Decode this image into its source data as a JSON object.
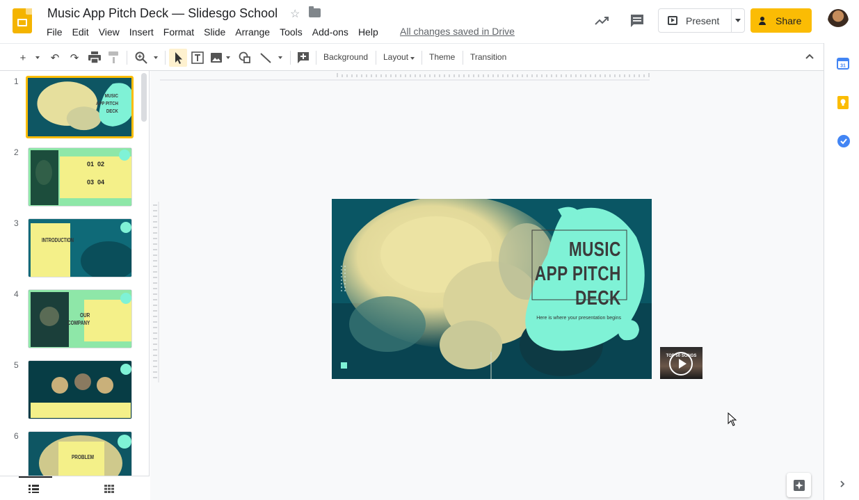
{
  "header": {
    "doc_title": "Music App Pitch Deck — Slidesgo School",
    "saved_status": "All changes saved in Drive",
    "present_label": "Present",
    "share_label": "Share"
  },
  "menu": [
    "File",
    "Edit",
    "View",
    "Insert",
    "Format",
    "Slide",
    "Arrange",
    "Tools",
    "Add-ons",
    "Help"
  ],
  "toolbar": {
    "background_label": "Background",
    "layout_label": "Layout",
    "theme_label": "Theme",
    "transition_label": "Transition"
  },
  "slides": [
    {
      "num": "1"
    },
    {
      "num": "2"
    },
    {
      "num": "3"
    },
    {
      "num": "4"
    },
    {
      "num": "5"
    },
    {
      "num": "6"
    }
  ],
  "thumbnails": {
    "t1_title": "MUSIC\nAPP PITCH\nDECK",
    "t2_n1": "01",
    "t2_n2": "02",
    "t2_n3": "03",
    "t2_n4": "04",
    "t3_title": "INTRODUCTION",
    "t4_title": "OUR\nCOMPANY",
    "t6_title": "PROBLEM"
  },
  "current_slide": {
    "title": "MUSIC\nAPP PITCH\nDECK",
    "subtitle": "Here is where your presentation begins"
  },
  "video": {
    "label": "TOP 50 SONGS"
  },
  "colors": {
    "share_yellow": "#fbbc04",
    "mint": "#7ef3d6",
    "teal_dark": "#0d4a56",
    "cream": "#e9e19a",
    "selected_border": "#fbbc04"
  }
}
